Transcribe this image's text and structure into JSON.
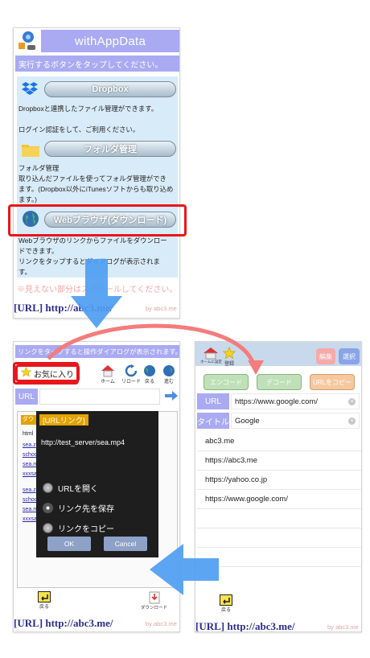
{
  "screen1": {
    "app_title": "withAppData",
    "instruction": "実行するボタンをタップしてください。",
    "dropbox": {
      "button_label": "Dropbox",
      "desc_line1": "Dropboxと連携したファイル管理ができます。",
      "desc_line2": "ログイン認証をして、ご利用ください。"
    },
    "folder": {
      "button_label": "フォルダ管理",
      "desc_line1": "フォルダ管理",
      "desc_line2": "取り込んだファイルを使ってフォルダ管理ができ",
      "desc_line3": "ます。(Dropbox以外にiTunesソフトからも取り込め",
      "desc_line4": "ます。)"
    },
    "browser": {
      "button_label": "Webブラウザ(ダウンロード)",
      "desc_line1": "Webブラウザのリンクからファイルをダウンロー",
      "desc_line2": "ドできます。",
      "desc_line3": "リンクをタップするとダイアログが表示されま",
      "desc_line4": "す。"
    },
    "scroll_hint": "※見えない部分はスクロールしてください。",
    "footer_url": "[URL] http://abc3.me/",
    "footer_by": "by abc3.me"
  },
  "screen2": {
    "instruction": "リンクをタップすると操作ダイアログが表示されます。",
    "favorites_label": "お気に入り",
    "toolbar": {
      "home_label": "ホーム",
      "reload_label": "リロード",
      "back_label": "戻る",
      "forward_label": "進む"
    },
    "url_label": "URL",
    "url_value": "",
    "web_fragments": [
      "ダウ",
      "html",
      "sea.z",
      "schoo",
      "sea.m",
      "xxxsa",
      "sea.z",
      "schoo",
      "sea.m",
      "xxxsa"
    ],
    "dialog": {
      "title": "[URLリンク]",
      "url": "http://test_server/sea.mp4",
      "options": [
        "URLを開く",
        "リンク先を保存",
        "リンクをコピー"
      ],
      "selected_option": "リンク先を保存",
      "ok_label": "OK",
      "cancel_label": "Cancel"
    },
    "back_label": "戻る",
    "download_label": "ダウンロード",
    "footer_url": "[URL] http://abc3.me/",
    "footer_by": "by abc3.me"
  },
  "screen3": {
    "home_label": "ホームに設定",
    "register_label": "登録",
    "edit_label": "編集",
    "select_label": "選択",
    "encode_label": "エンコード",
    "decode_label": "デコード",
    "copy_label": "URLをコピー",
    "url_label": "URL",
    "url_value": "https://www.google.com/",
    "title_label": "タイトル",
    "title_value": "Google",
    "bookmarks": [
      "abc3.me",
      "https://abc3.me",
      "https://yahoo.co.jp",
      "https://www.google.com/"
    ],
    "back_label": "戻る",
    "footer_url": "[URL] http://abc3.me/",
    "footer_by": "by abc3.me"
  },
  "colors": {
    "accent_purple": "#a9aaf2",
    "highlight_red": "#e8161a",
    "arrow_blue": "#4e9df2",
    "curve_pink": "#f47c7c",
    "footer_blue": "#2b2b8f"
  }
}
